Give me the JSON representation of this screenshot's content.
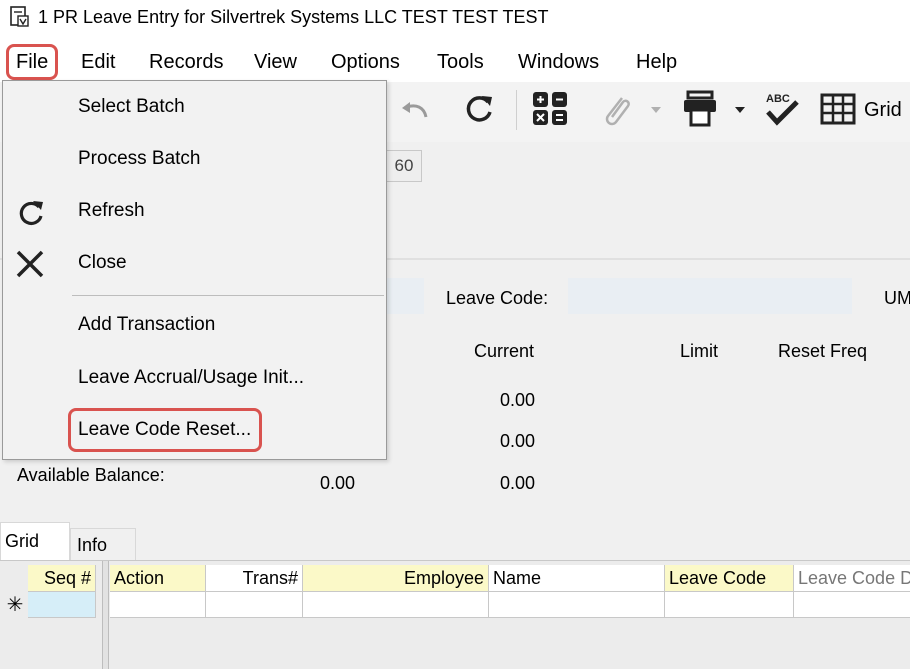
{
  "window": {
    "title": "1 PR Leave Entry for Silvertrek Systems LLC TEST TEST TEST",
    "icon": "document-icon"
  },
  "menubar": {
    "items": [
      "File",
      "Edit",
      "Records",
      "View",
      "Options",
      "Tools",
      "Windows",
      "Help"
    ]
  },
  "file_menu": {
    "items": [
      {
        "label": "Select Batch",
        "icon": ""
      },
      {
        "label": "Process Batch",
        "icon": ""
      },
      {
        "label": "Refresh",
        "icon": "refresh-icon"
      },
      {
        "label": "Close",
        "icon": "close-icon"
      },
      {
        "label": "Add Transaction",
        "icon": ""
      },
      {
        "label": "Leave Accrual/Usage Init...",
        "icon": ""
      },
      {
        "label": "Leave Code Reset...",
        "icon": ""
      }
    ]
  },
  "toolbar": {
    "grid_label": "Grid"
  },
  "form": {
    "batch_number": "60",
    "leave_code_label": "Leave Code:",
    "um_label": "UM",
    "headers": {
      "current": "Current",
      "limit": "Limit",
      "reset_freq": "Reset Freq"
    },
    "current_values": [
      "0.00",
      "0.00",
      "0.00"
    ],
    "available_balance_label": "Available Balance:",
    "available_balance_value": "0.00"
  },
  "tabs": [
    "Grid",
    "Info"
  ],
  "grid": {
    "columns": [
      "Seq #",
      "Action",
      "Trans#",
      "Employee",
      "Name",
      "Leave Code",
      "Leave Code D"
    ],
    "new_row_indicator": "✳"
  },
  "colors": {
    "highlight": "#d9534f",
    "header_yellow": "#fbf9c8",
    "seq_cell": "#d6eef8"
  }
}
